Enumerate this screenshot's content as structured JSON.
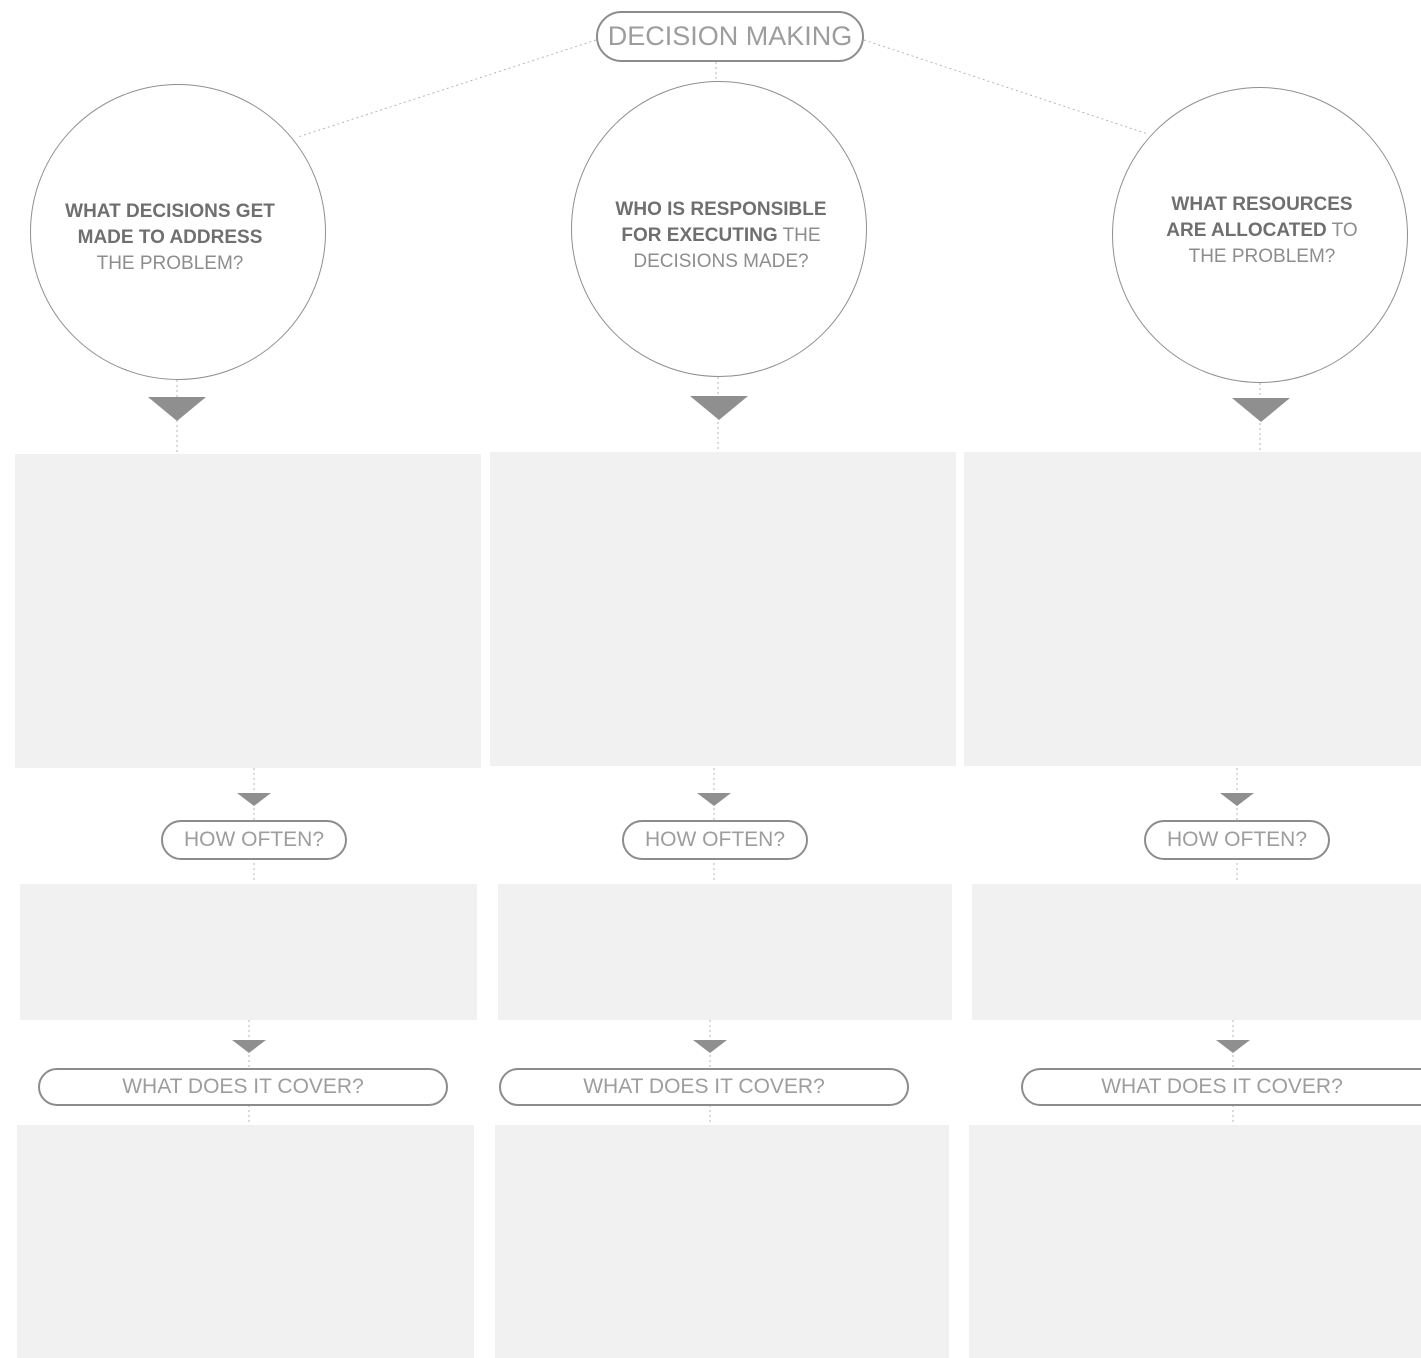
{
  "diagram": {
    "title": "DECISION MAKING",
    "columns": [
      {
        "question_bold_line1": "WHAT DECISIONS GET",
        "question_bold_line2": "MADE TO ADDRESS",
        "question_line3": "THE PROBLEM?",
        "how_often_label": "HOW OFTEN?",
        "cover_label": "WHAT DOES IT COVER?"
      },
      {
        "question_bold_line1": "WHO IS RESPONSIBLE",
        "question_bold_line2": "FOR EXECUTING",
        "question_line2_rest": " THE",
        "question_line3": "DECISIONS MADE?",
        "how_often_label": "HOW OFTEN?",
        "cover_label": "WHAT DOES IT COVER?"
      },
      {
        "question_bold_line1": "WHAT RESOURCES",
        "question_bold_line2": "ARE ALLOCATED",
        "question_line2_rest": " TO",
        "question_line3": "THE PROBLEM?",
        "how_often_label": "HOW OFTEN?",
        "cover_label": "WHAT DOES IT COVER?"
      }
    ]
  },
  "colors": {
    "box_fill": "#f1f1f1",
    "outline": "#8c8c8c",
    "label_text": "#9d9d9d",
    "question_bold": "#6f6f6f",
    "arrow": "#8f8f8f"
  }
}
